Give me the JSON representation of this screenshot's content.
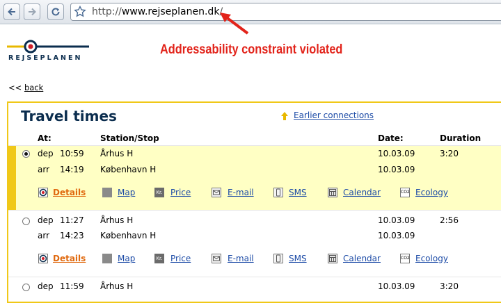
{
  "browser": {
    "url_prefix": "http://",
    "url_domain": "www.rejseplanen.dk",
    "url_suffix": "/"
  },
  "annotation": {
    "text": "Addressability constraint violated",
    "color": "#e2231a"
  },
  "logo": {
    "text": "REJSEPLANEN"
  },
  "nav": {
    "back_prefix": "<< ",
    "back_label": "back"
  },
  "page": {
    "title": "Travel times",
    "earlier_label": "Earlier connections"
  },
  "table": {
    "headers": {
      "at": "At:",
      "station": "Station/Stop",
      "date": "Date:",
      "duration": "Duration"
    },
    "connections": [
      {
        "selected": true,
        "dep_label": "dep",
        "dep_time": "10:59",
        "dep_station": "Århus H",
        "dep_date": "10.03.09",
        "arr_label": "arr",
        "arr_time": "14:19",
        "arr_station": "København H",
        "arr_date": "10.03.09",
        "duration": "3:20"
      },
      {
        "selected": false,
        "dep_label": "dep",
        "dep_time": "11:27",
        "dep_station": "Århus H",
        "dep_date": "10.03.09",
        "arr_label": "arr",
        "arr_time": "14:23",
        "arr_station": "København H",
        "arr_date": "10.03.09",
        "duration": "2:56"
      },
      {
        "selected": false,
        "dep_label": "dep",
        "dep_time": "11:59",
        "dep_station": "Århus H",
        "dep_date": "10.03.09",
        "duration": "3:20"
      }
    ],
    "actions": {
      "details": "Details",
      "map": "Map",
      "price": "Price",
      "email": "E-mail",
      "sms": "SMS",
      "calendar": "Calendar",
      "ecology": "Ecology"
    },
    "icon_text": {
      "price": "Kr.",
      "ecology": "CO2"
    }
  },
  "colors": {
    "accent_yellow": "#f0c818",
    "selected_row": "#ffffc4",
    "link_blue": "#1b4aa6",
    "details_orange": "#e06a10",
    "title_navy": "#0b2d4e"
  }
}
